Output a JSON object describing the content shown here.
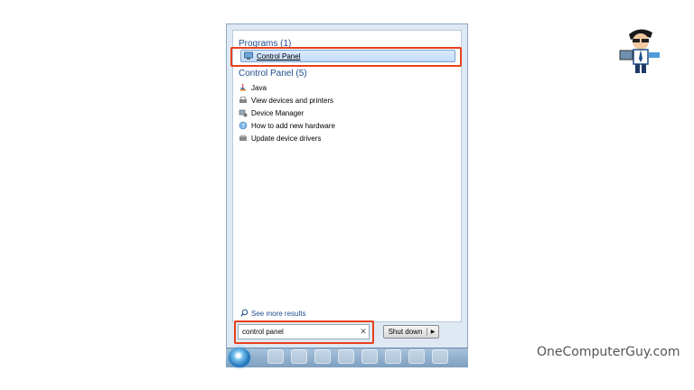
{
  "start_menu": {
    "sections": {
      "programs_heading": "Programs (1)",
      "control_panel_heading": "Control Panel (5)"
    },
    "programs": [
      {
        "label": "Control Panel",
        "icon": "control-panel-icon"
      }
    ],
    "control_panel_items": [
      {
        "label": "Java",
        "icon": "java-icon"
      },
      {
        "label": "View devices and printers",
        "icon": "printer-icon"
      },
      {
        "label": "Device Manager",
        "icon": "device-manager-icon"
      },
      {
        "label": "How to add new hardware",
        "icon": "help-icon"
      },
      {
        "label": "Update device drivers",
        "icon": "driver-icon"
      }
    ],
    "see_more": "See more results",
    "search": {
      "value": "control panel"
    },
    "shutdown_label": "Shut down"
  },
  "watermark": "OneComputerGuy.com",
  "colors": {
    "highlight_border": "#e8401c",
    "heading": "#1e4e8c"
  }
}
